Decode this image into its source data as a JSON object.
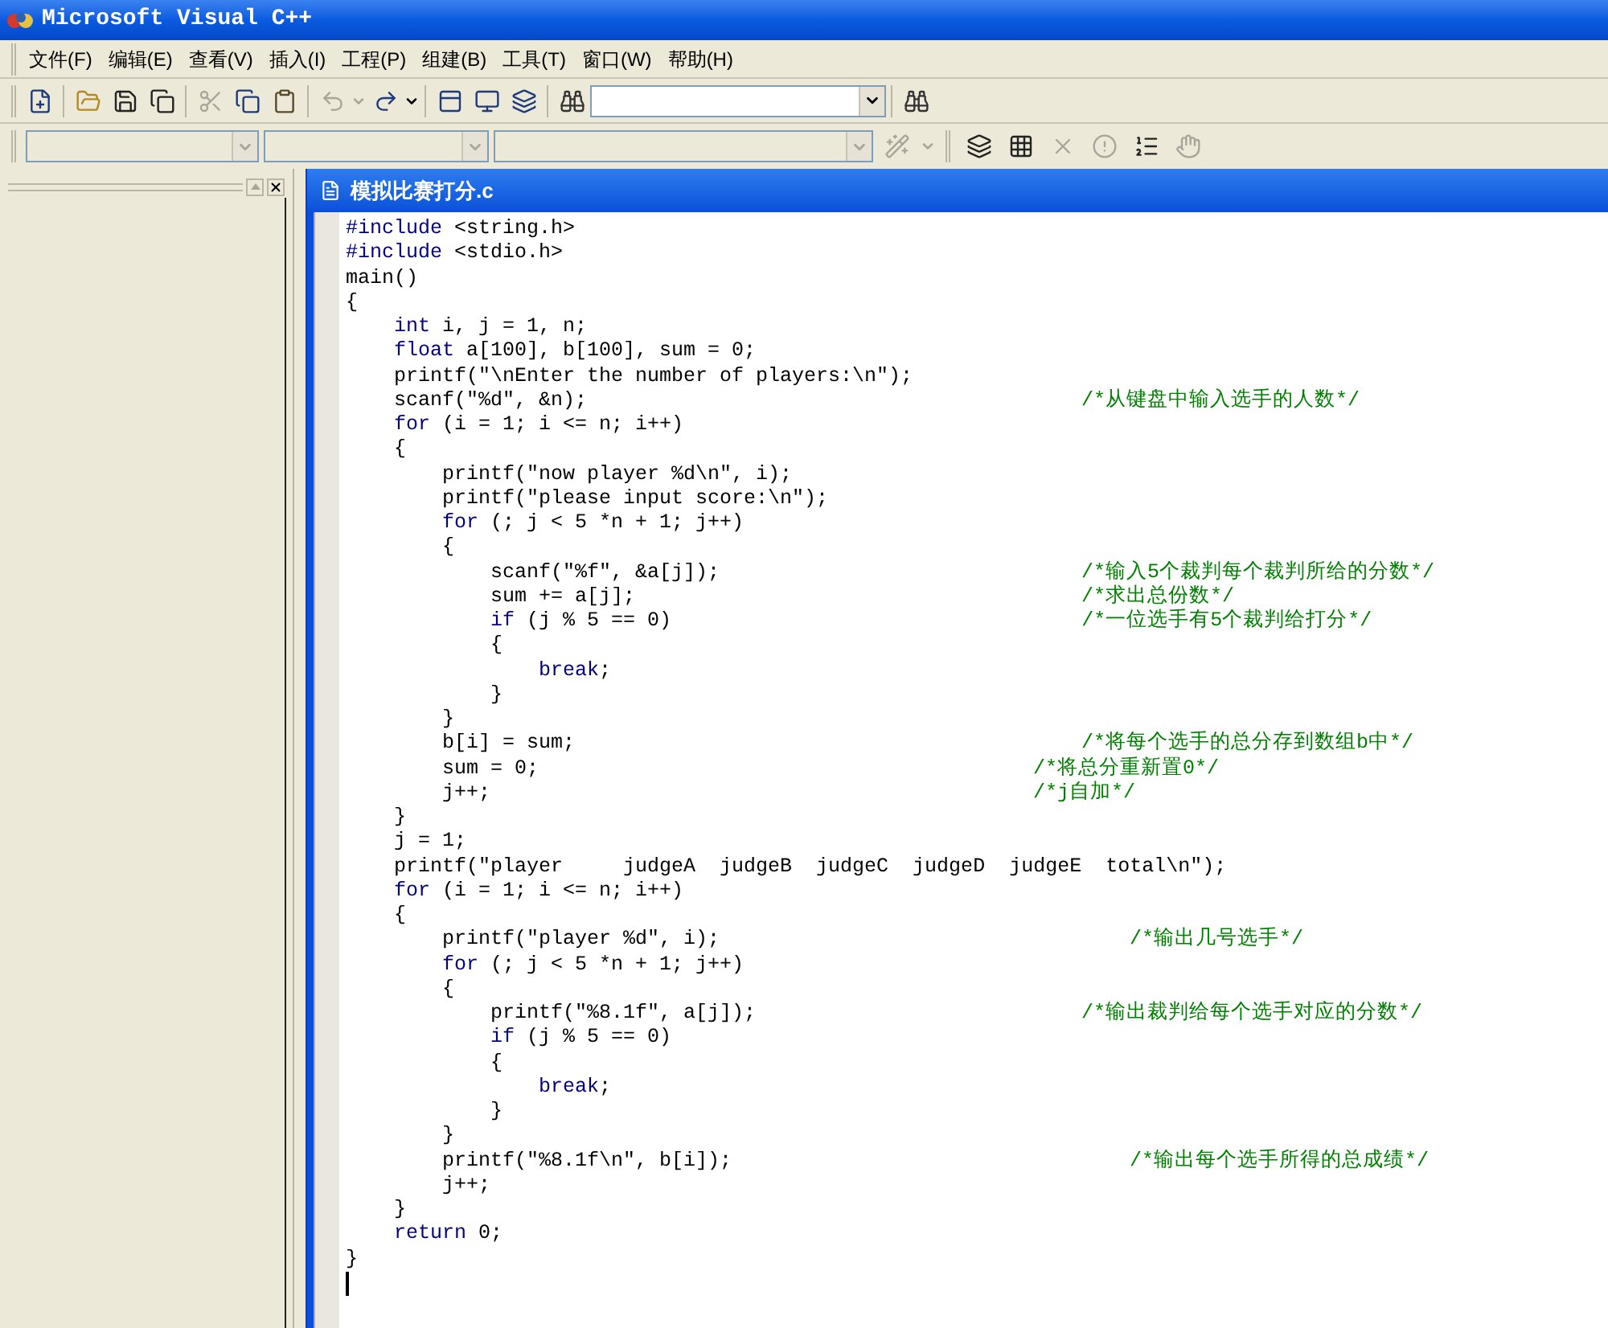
{
  "window": {
    "title": "Microsoft Visual C++"
  },
  "menu": [
    "文件(F)",
    "编辑(E)",
    "查看(V)",
    "插入(I)",
    "工程(P)",
    "组建(B)",
    "工具(T)",
    "窗口(W)",
    "帮助(H)"
  ],
  "document": {
    "title": "模拟比赛打分.c",
    "lines": [
      {
        "tokens": [
          {
            "kind": "keyword",
            "text": "#include"
          },
          {
            "kind": "text",
            "text": " <string.h>"
          }
        ]
      },
      {
        "tokens": [
          {
            "kind": "keyword",
            "text": "#include"
          },
          {
            "kind": "text",
            "text": " <stdio.h>"
          }
        ]
      },
      {
        "tokens": [
          {
            "kind": "text",
            "text": "main()"
          }
        ]
      },
      {
        "tokens": [
          {
            "kind": "text",
            "text": "{"
          }
        ]
      },
      {
        "tokens": [
          {
            "kind": "keyword",
            "text": "    int"
          },
          {
            "kind": "text",
            "text": " i, j = 1, n;"
          }
        ]
      },
      {
        "tokens": [
          {
            "kind": "keyword",
            "text": "    float"
          },
          {
            "kind": "text",
            "text": " a[100], b[100], sum = 0;"
          }
        ]
      },
      {
        "tokens": [
          {
            "kind": "text",
            "text": "    printf(\"\\nEnter the number of players:\\n\");"
          }
        ]
      },
      {
        "tokens": [
          {
            "kind": "text",
            "text": "    scanf(\"%d\", &n);"
          }
        ],
        "comment": "/*从键盘中输入选手的人数*/"
      },
      {
        "tokens": [
          {
            "kind": "keyword",
            "text": "    for"
          },
          {
            "kind": "text",
            "text": " (i = 1; i <= n; i++)"
          }
        ]
      },
      {
        "tokens": [
          {
            "kind": "text",
            "text": "    {"
          }
        ]
      },
      {
        "tokens": [
          {
            "kind": "text",
            "text": "        printf(\"now player %d\\n\", i);"
          }
        ]
      },
      {
        "tokens": [
          {
            "kind": "text",
            "text": "        printf(\"please input score:\\n\");"
          }
        ]
      },
      {
        "tokens": [
          {
            "kind": "keyword",
            "text": "        for"
          },
          {
            "kind": "text",
            "text": " (; j < 5 *n + 1; j++)"
          }
        ]
      },
      {
        "tokens": [
          {
            "kind": "text",
            "text": "        {"
          }
        ]
      },
      {
        "tokens": [
          {
            "kind": "text",
            "text": "            scanf(\"%f\", &a[j]);"
          }
        ],
        "comment": "/*输入5个裁判每个裁判所给的分数*/"
      },
      {
        "tokens": [
          {
            "kind": "text",
            "text": "            sum += a[j];"
          }
        ],
        "comment": "/*求出总份数*/"
      },
      {
        "tokens": [
          {
            "kind": "keyword",
            "text": "            if"
          },
          {
            "kind": "text",
            "text": " (j % 5 == 0)"
          }
        ],
        "comment": "/*一位选手有5个裁判给打分*/"
      },
      {
        "tokens": [
          {
            "kind": "text",
            "text": "            {"
          }
        ]
      },
      {
        "tokens": [
          {
            "kind": "keyword",
            "text": "                break"
          },
          {
            "kind": "text",
            "text": ";"
          }
        ]
      },
      {
        "tokens": [
          {
            "kind": "text",
            "text": "            }"
          }
        ]
      },
      {
        "tokens": [
          {
            "kind": "text",
            "text": "        }"
          }
        ]
      },
      {
        "tokens": [
          {
            "kind": "text",
            "text": "        b[i] = sum;"
          }
        ],
        "comment": "/*将每个选手的总分存到数组b中*/"
      },
      {
        "tokens": [
          {
            "kind": "text",
            "text": "        sum = 0;"
          }
        ],
        "comment": "/*将总分重新置0*/"
      },
      {
        "tokens": [
          {
            "kind": "text",
            "text": "        j++;"
          }
        ],
        "comment": "/*j自加*/"
      },
      {
        "tokens": [
          {
            "kind": "text",
            "text": "    }"
          }
        ]
      },
      {
        "tokens": [
          {
            "kind": "text",
            "text": "    j = 1;"
          }
        ]
      },
      {
        "tokens": [
          {
            "kind": "text",
            "text": "    printf(\"player     judgeA  judgeB  judgeC  judgeD  judgeE  total\\n\");"
          }
        ]
      },
      {
        "tokens": [
          {
            "kind": "keyword",
            "text": "    for"
          },
          {
            "kind": "text",
            "text": " (i = 1; i <= n; i++)"
          }
        ]
      },
      {
        "tokens": [
          {
            "kind": "text",
            "text": "    {"
          }
        ]
      },
      {
        "tokens": [
          {
            "kind": "text",
            "text": "        printf(\"player %d\", i);"
          }
        ],
        "comment": "/*输出几号选手*/"
      },
      {
        "tokens": [
          {
            "kind": "keyword",
            "text": "        for"
          },
          {
            "kind": "text",
            "text": " (; j < 5 *n + 1; j++)"
          }
        ]
      },
      {
        "tokens": [
          {
            "kind": "text",
            "text": "        {"
          }
        ]
      },
      {
        "tokens": [
          {
            "kind": "text",
            "text": "            printf(\"%8.1f\", a[j]);"
          }
        ],
        "comment": "/*输出裁判给每个选手对应的分数*/"
      },
      {
        "tokens": [
          {
            "kind": "keyword",
            "text": "            if"
          },
          {
            "kind": "text",
            "text": " (j % 5 == 0)"
          }
        ]
      },
      {
        "tokens": [
          {
            "kind": "text",
            "text": "            {"
          }
        ]
      },
      {
        "tokens": [
          {
            "kind": "keyword",
            "text": "                break"
          },
          {
            "kind": "text",
            "text": ";"
          }
        ]
      },
      {
        "tokens": [
          {
            "kind": "text",
            "text": "            }"
          }
        ]
      },
      {
        "tokens": [
          {
            "kind": "text",
            "text": "        }"
          }
        ]
      },
      {
        "tokens": [
          {
            "kind": "text",
            "text": "        printf(\"%8.1f\\n\", b[i]);"
          }
        ],
        "comment": "/*输出每个选手所得的总成绩*/"
      },
      {
        "tokens": [
          {
            "kind": "text",
            "text": "        j++;"
          }
        ]
      },
      {
        "tokens": [
          {
            "kind": "text",
            "text": "    }"
          }
        ]
      },
      {
        "tokens": [
          {
            "kind": "keyword",
            "text": "    return"
          },
          {
            "kind": "text",
            "text": " 0;"
          }
        ]
      },
      {
        "tokens": [
          {
            "kind": "text",
            "text": "}"
          }
        ]
      }
    ]
  }
}
